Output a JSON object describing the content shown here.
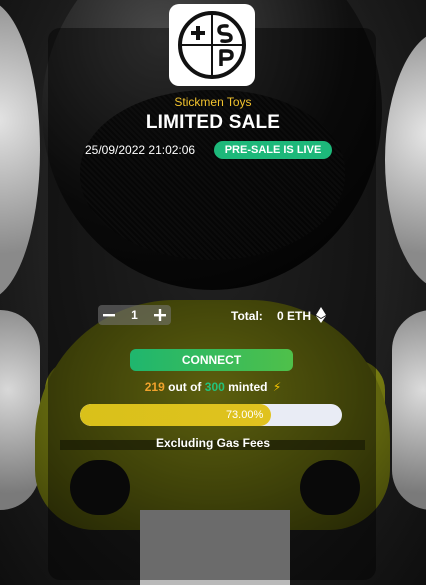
{
  "brand": {
    "name": "Stickmen Toys",
    "logo_text": "SP+",
    "logo_icon": "sp-plus-logo-icon"
  },
  "sale": {
    "title": "LIMITED SALE",
    "datetime": "25/09/2022 21:02:06",
    "status_badge": "PRE-SALE IS LIVE"
  },
  "mint": {
    "decrement_icon": "minus-icon",
    "increment_icon": "plus-icon",
    "quantity": "1",
    "total_label": "Total:",
    "total_value": "0 ETH",
    "currency_icon": "ethereum-icon",
    "connect_label": "CONNECT",
    "minted_count": "219",
    "minted_sep": " out of ",
    "minted_total": "300",
    "minted_suffix": " minted",
    "minted_icon": "lightning-bolt-icon",
    "progress_fraction": 0.73,
    "progress_label": "73.00%",
    "note": "Excluding Gas Fees"
  },
  "colors": {
    "accent_green": "#1db87a",
    "brand_yellow": "#f2c32e",
    "progress_fill": "#d9c11a",
    "progress_track": "#e9ecf5",
    "minted_orange": "#f0a22c"
  }
}
